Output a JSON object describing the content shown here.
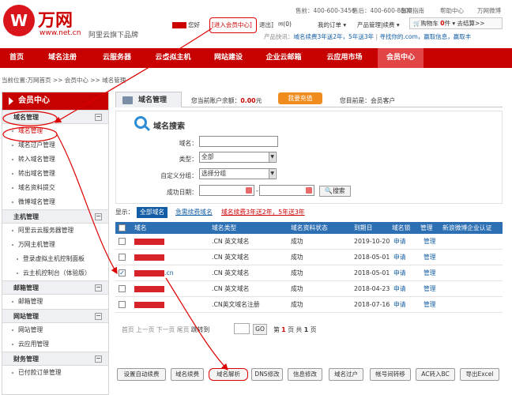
{
  "brand": {
    "logo_mark": "W",
    "name": "万网",
    "url": "www.net.cn",
    "slogan": "阿里云旗下品牌"
  },
  "topbar": {
    "sales": "售前：400-600-3456",
    "after_sales": "售后：400-600-8500",
    "record": "备案指南",
    "help": "帮助中心",
    "weibo": "万网微博"
  },
  "user": {
    "greeting": "您好",
    "enter_member": "[进入会员中心]",
    "logout": "退出]",
    "messages": "(0)",
    "orders": "我的订单",
    "products": "产品管理|续费"
  },
  "cart": {
    "label": "购物车",
    "count": "0",
    "unit": "件",
    "checkout": "去结算>>"
  },
  "promo": {
    "prefix": "产品快讯：",
    "text": "域名续费3年送2年，5年送3年",
    "sep": "|",
    "text2": "寻找你的.com，赢取信息，赢取丰",
    "red_hex": "#cc0000"
  },
  "nav": [
    "首页",
    "域名注册",
    "云服务器",
    "云虚拟主机",
    "网站建设",
    "企业云邮箱",
    "云应用市场",
    "会员中心"
  ],
  "nav_active_index": 7,
  "breadcrumb": "当前位置:万网首页 >> 会员中心 >> 域名管理",
  "sidebar": {
    "title": "会员中心",
    "groups": [
      {
        "label": "域名管理",
        "items": [
          "域名管理",
          "域名过户管理",
          "转入域名管理",
          "转出域名管理",
          "域名资料提交",
          "微博域名管理"
        ]
      },
      {
        "label": "主机管理",
        "items": [
          "阿里云云服务器管理",
          "万网主机管理",
          "登录虚拟主机控制面板",
          "云主机控制台（体验版）"
        ]
      },
      {
        "label": "邮箱管理",
        "items": [
          "邮箱管理"
        ]
      },
      {
        "label": "网站管理",
        "items": [
          "网站管理",
          "云应用管理"
        ]
      },
      {
        "label": "财务管理",
        "items": [
          "已付款订单管理"
        ]
      }
    ]
  },
  "main": {
    "tab": "域名管理",
    "balance_label": "您当前账户余额：",
    "balance_value": "0.00",
    "balance_unit": "元",
    "recharge": "我要充值",
    "identity": "您目前是：会员客户"
  },
  "search": {
    "title": "域名搜索",
    "domain_label": "域名：",
    "type_label": "类型：",
    "type_value": "全部",
    "group_label": "自定义分组：",
    "group_value": "选择分组",
    "date_label": "成功日期：",
    "date_sep": "-",
    "button": "搜索"
  },
  "filter": {
    "show": "显示：",
    "all": "全部域名",
    "renew": "急需续费域名",
    "promo": "域名续费3年送2年，5年送3年"
  },
  "table": {
    "headers": [
      "域名",
      "域名类型",
      "域名资料状态",
      "到期日",
      "域名锁",
      "管理",
      "新浪微博企业认证"
    ],
    "rows": [
      {
        "domain": "",
        "type": ".CN 英文域名",
        "status": "成功",
        "expire": "2019-10-20",
        "lock": "申请",
        "manage": "管理",
        "checked": false
      },
      {
        "domain": "",
        "type": ".CN 英文域名",
        "status": "成功",
        "expire": "2018-05-01",
        "lock": "申请",
        "manage": "管理",
        "checked": false
      },
      {
        "domain": ".cn",
        "type": ".CN 英文域名",
        "status": "成功",
        "expire": "2018-05-01",
        "lock": "申请",
        "manage": "管理",
        "checked": true
      },
      {
        "domain": "",
        "type": ".CN 英文域名",
        "status": "成功",
        "expire": "2018-04-23",
        "lock": "申请",
        "manage": "管理",
        "checked": false
      },
      {
        "domain": "",
        "type": ".CN英文域名注册",
        "status": "成功",
        "expire": "2018-07-16",
        "lock": "申请",
        "manage": "管理",
        "checked": false
      }
    ]
  },
  "pager": {
    "nav": "首页  上一页  下一页  尾页",
    "jump": "跳转到",
    "go": "GO",
    "info_a": "第",
    "page": "1",
    "info_b": "页  共",
    "total": "1",
    "info_c": "页"
  },
  "actions": [
    "设置自动续费",
    "域名续费",
    "域名解析",
    "DNS修改",
    "信息修改",
    "域名过户",
    "帐号间转移",
    "AC转入BC",
    "导出Excel"
  ]
}
